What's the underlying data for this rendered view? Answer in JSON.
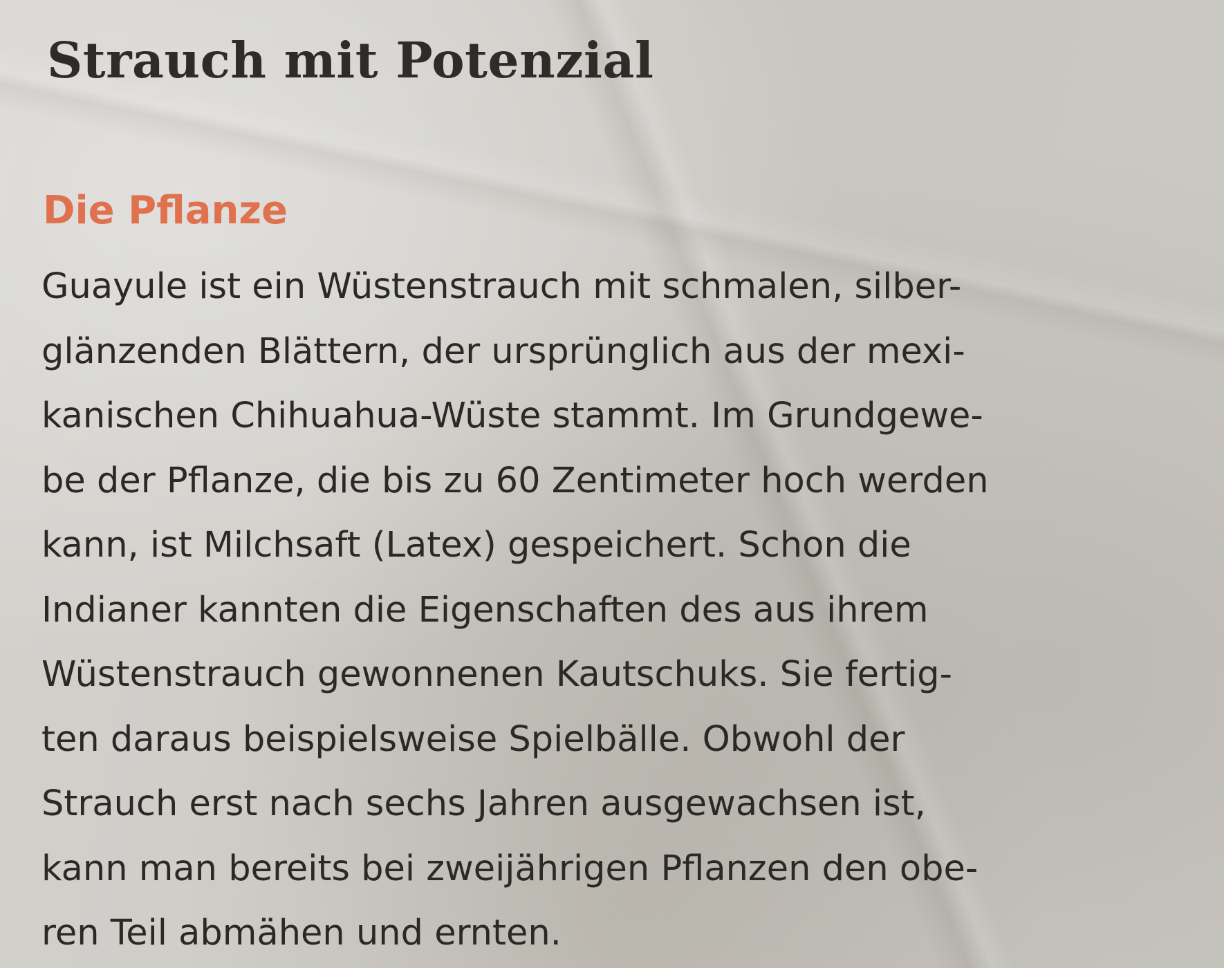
{
  "article": {
    "headline": "Strauch mit Potenzial",
    "section_heading": "Die Pflanze",
    "body_lines": [
      "Guayule ist ein Wüstenstrauch mit schmalen, silber-",
      "glänzenden Blättern, der ursprünglich aus der mexi-",
      "kanischen Chihuahua-Wüste stammt. Im Grundgewe-",
      "be der Pflanze, die bis zu 60 Zentimeter hoch werden",
      "kann, ist Milchsaft (Latex) gespeichert. Schon die",
      "Indianer kannten die Eigenschaften des aus ihrem",
      "Wüstenstrauch gewonnenen Kautschuks. Sie fertig-",
      "ten daraus beispielsweise Spielbälle. Obwohl der",
      "Strauch erst nach sechs Jahren ausgewachsen ist,",
      "kann man bereits bei zweijährigen Pflanzen den obe-",
      "ren Teil abmähen und ernten."
    ]
  },
  "colors": {
    "paper": "#cfcdc8",
    "ink": "#2b2926",
    "accent": "#e0714e"
  }
}
